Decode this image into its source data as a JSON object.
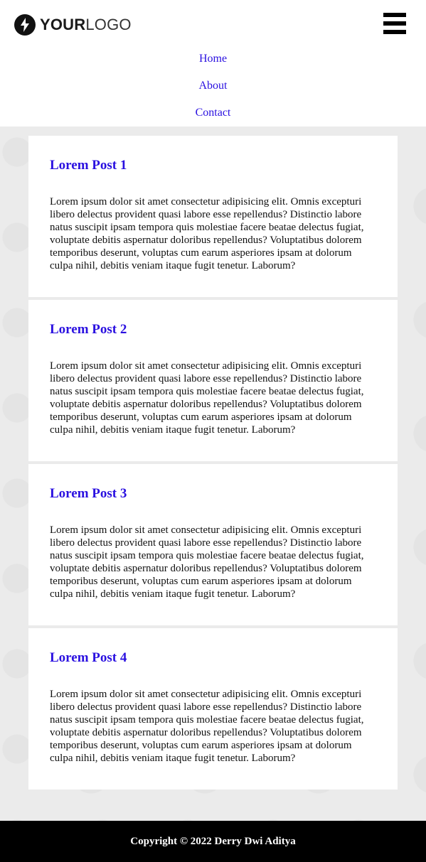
{
  "header": {
    "logo": {
      "bold": "YOUR",
      "light": "LOGO",
      "icon": "lightning-bolt-icon"
    },
    "menu_icon": "hamburger-menu-icon"
  },
  "nav": {
    "items": [
      {
        "label": "Home"
      },
      {
        "label": "About"
      },
      {
        "label": "Contact"
      }
    ]
  },
  "posts": [
    {
      "title": "Lorem Post 1",
      "body": "Lorem ipsum dolor sit amet consectetur adipisicing elit. Omnis excepturi libero delectus provident quasi labore esse repellendus? Distinctio labore natus suscipit ipsam tempora quis molestiae facere beatae delectus fugiat, voluptate debitis aspernatur doloribus repellendus? Voluptatibus dolorem temporibus deserunt, voluptas cum earum asperiores ipsam at dolorum culpa nihil, debitis veniam itaque fugit tenetur. Laborum?"
    },
    {
      "title": "Lorem Post 2",
      "body": "Lorem ipsum dolor sit amet consectetur adipisicing elit. Omnis excepturi libero delectus provident quasi labore esse repellendus? Distinctio labore natus suscipit ipsam tempora quis molestiae facere beatae delectus fugiat, voluptate debitis aspernatur doloribus repellendus? Voluptatibus dolorem temporibus deserunt, voluptas cum earum asperiores ipsam at dolorum culpa nihil, debitis veniam itaque fugit tenetur. Laborum?"
    },
    {
      "title": "Lorem Post 3",
      "body": "Lorem ipsum dolor sit amet consectetur adipisicing elit. Omnis excepturi libero delectus provident quasi labore esse repellendus? Distinctio labore natus suscipit ipsam tempora quis molestiae facere beatae delectus fugiat, voluptate debitis aspernatur doloribus repellendus? Voluptatibus dolorem temporibus deserunt, voluptas cum earum asperiores ipsam at dolorum culpa nihil, debitis veniam itaque fugit tenetur. Laborum?"
    },
    {
      "title": "Lorem Post 4",
      "body": "Lorem ipsum dolor sit amet consectetur adipisicing elit. Omnis excepturi libero delectus provident quasi labore esse repellendus? Distinctio labore natus suscipit ipsam tempora quis molestiae facere beatae delectus fugiat, voluptate debitis aspernatur doloribus repellendus? Voluptatibus dolorem temporibus deserunt, voluptas cum earum asperiores ipsam at dolorum culpa nihil, debitis veniam itaque fugit tenetur. Laborum?"
    }
  ],
  "footer": {
    "text": "Copyright © 2022 Derry Dwi Aditya"
  },
  "colors": {
    "link": "#2a10e0",
    "background": "#ebebeb",
    "footer": "#000000"
  }
}
